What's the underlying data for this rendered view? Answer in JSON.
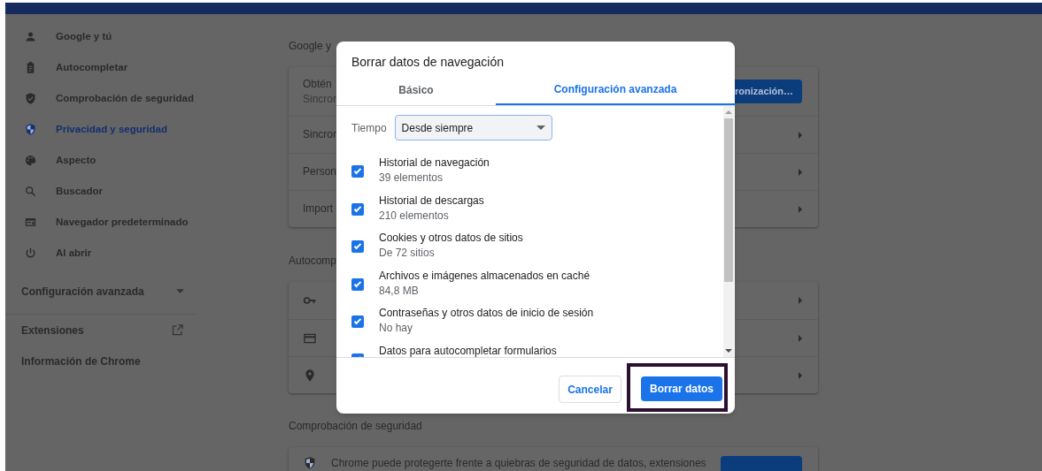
{
  "sidebar": {
    "items": [
      {
        "label": "Google y tú",
        "selected": false
      },
      {
        "label": "Autocompletar",
        "selected": false
      },
      {
        "label": "Comprobación de seguridad",
        "selected": false
      },
      {
        "label": "Privacidad y seguridad",
        "selected": true
      },
      {
        "label": "Aspecto",
        "selected": false
      },
      {
        "label": "Buscador",
        "selected": false
      },
      {
        "label": "Navegador predeterminado",
        "selected": false
      },
      {
        "label": "Al abrir",
        "selected": false
      }
    ],
    "advanced": {
      "label": "Configuración avanzada",
      "expanded": false
    },
    "links": [
      {
        "label": "Extensiones",
        "external": true
      },
      {
        "label": "Información de Chrome",
        "external": false
      }
    ]
  },
  "sections": [
    {
      "heading": "Google y",
      "rows": [
        {
          "kind": "button",
          "title": "Obtén",
          "subtitle": "Sincron",
          "button": "ronización…"
        },
        {
          "kind": "link",
          "title": "Sincron"
        },
        {
          "kind": "link",
          "title": "Person"
        },
        {
          "kind": "link",
          "title": "Import"
        }
      ]
    },
    {
      "heading": "Autocomp",
      "rows": [
        {
          "kind": "link"
        },
        {
          "kind": "link"
        },
        {
          "kind": "link"
        }
      ]
    },
    {
      "heading": "Comprobación de seguridad",
      "rows": [
        {
          "kind": "button",
          "title": "Chrome puede protegerte frente a quiebras de seguridad de datos, extensiones"
        }
      ]
    }
  ],
  "dialog": {
    "title": "Borrar datos de navegación",
    "tabs": [
      {
        "label": "Básico",
        "selected": false
      },
      {
        "label": "Configuración avanzada",
        "selected": true
      }
    ],
    "time": {
      "label": "Tiempo",
      "value": "Desde siempre"
    },
    "options": [
      {
        "title": "Historial de navegación",
        "detail": "39 elementos",
        "checked": true
      },
      {
        "title": "Historial de descargas",
        "detail": "210 elementos",
        "checked": true
      },
      {
        "title": "Cookies y otros datos de sitios",
        "detail": "De 72 sitios",
        "checked": true
      },
      {
        "title": "Archivos e imágenes almacenados en caché",
        "detail": "84,8 MB",
        "checked": true
      },
      {
        "title": "Contraseñas y otros datos de inicio de sesión",
        "detail": "No hay",
        "checked": true
      },
      {
        "title": "Datos para autocompletar formularios",
        "checked": true
      }
    ],
    "cancel": "Cancelar",
    "confirm": {
      "label": "Borrar datos",
      "highlighted": true
    }
  }
}
